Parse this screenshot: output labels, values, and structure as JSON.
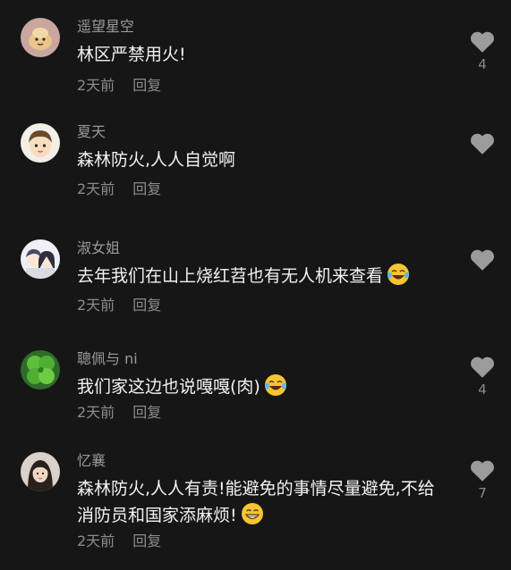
{
  "colors": {
    "background": "#161616",
    "username": "#9a9a9a",
    "text": "#f2f2f2",
    "meta": "#8c8c8c",
    "heart": "#9b9b9b"
  },
  "comments": [
    {
      "username": "遥望星空",
      "text": "林区严禁用火!",
      "time": "2天前",
      "reply": "回复",
      "likes": "4",
      "avatar": "cartoon-bread-avatar",
      "emoji": ""
    },
    {
      "username": "夏天",
      "text": "森林防火,人人自觉啊",
      "time": "2天前",
      "reply": "回复",
      "likes": "",
      "avatar": "cartoon-boy-avatar",
      "emoji": ""
    },
    {
      "username": "淑女姐",
      "text": "去年我们在山上烧红苕也有无人机来查看",
      "time": "2天前",
      "reply": "回复",
      "likes": "",
      "avatar": "anime-couple-avatar",
      "emoji": "laughing-tears-emoji"
    },
    {
      "username": "聰佩与 ni",
      "text": "我们家这边也说嘎嘎(肉)",
      "time": "2天前",
      "reply": "回复",
      "likes": "4",
      "avatar": "clover-avatar",
      "emoji": "laughing-tears-emoji"
    },
    {
      "username": "忆襄",
      "text": "森林防火,人人有责!能避免的事情尽量避免,不给消防员和国家添麻烦!",
      "time": "2天前",
      "reply": "回复",
      "likes": "7",
      "avatar": "girl-photo-avatar",
      "emoji": "grinning-emoji"
    }
  ]
}
